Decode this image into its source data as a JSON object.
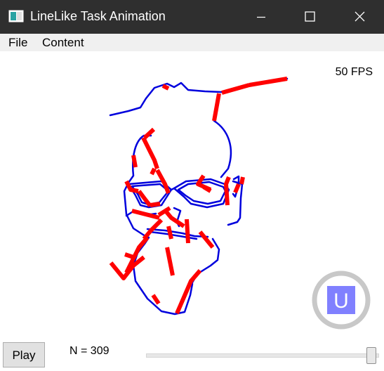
{
  "window": {
    "title": "LineLike Task Animation",
    "icon": "app-icon",
    "controls": [
      "minimize-icon",
      "maximize-icon",
      "close-icon"
    ]
  },
  "menu": {
    "items": [
      {
        "label": "File"
      },
      {
        "label": "Content"
      }
    ]
  },
  "canvas": {
    "fps": "50 FPS",
    "colors": {
      "outline": "#0000dd",
      "highlight": "#ff0000",
      "logo_ring": "#c8c8c8",
      "logo_fill": "#8080ff"
    },
    "logo": {
      "letter": "U",
      "icon": "u-logo-icon"
    }
  },
  "controls": {
    "play_label": "Play",
    "n_label": "N = 309",
    "slider_level": 1.0
  }
}
